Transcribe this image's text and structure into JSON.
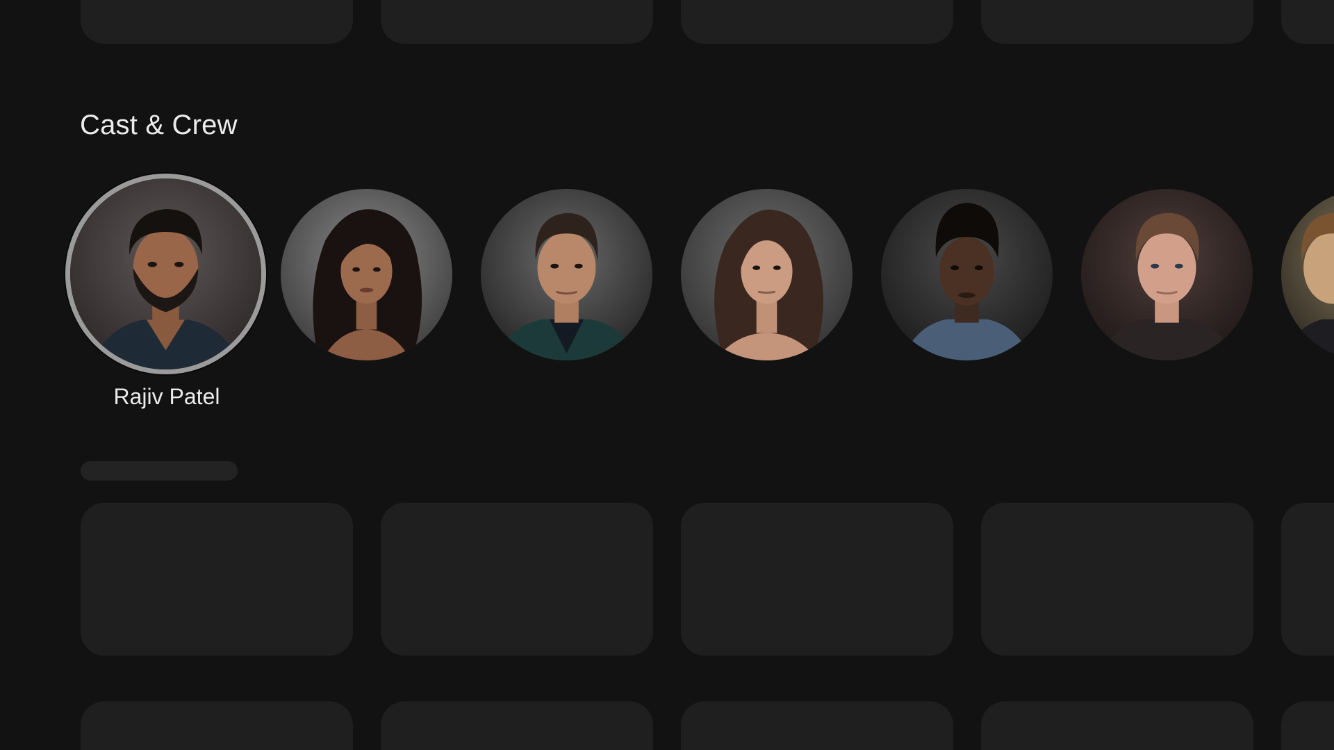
{
  "cast_section": {
    "title": "Cast & Crew",
    "focused_name": "Rajiv Patel",
    "members": [
      {
        "icon": "portrait-man-beard-dark-hair",
        "focused": true
      },
      {
        "icon": "portrait-woman-long-dark-hair",
        "focused": false
      },
      {
        "icon": "portrait-man-short-brown-hair",
        "focused": false
      },
      {
        "icon": "portrait-woman-shoulder-brown-hair",
        "focused": false
      },
      {
        "icon": "portrait-young-man-tall-hair",
        "focused": false
      },
      {
        "icon": "portrait-man-light-hair",
        "focused": false
      },
      {
        "icon": "portrait-man-partially-visible",
        "focused": false
      }
    ]
  },
  "colors": {
    "background": "#121212",
    "card": "#1f1f1f",
    "text": "#ececec",
    "focus_ring": "#9b9b9b"
  }
}
